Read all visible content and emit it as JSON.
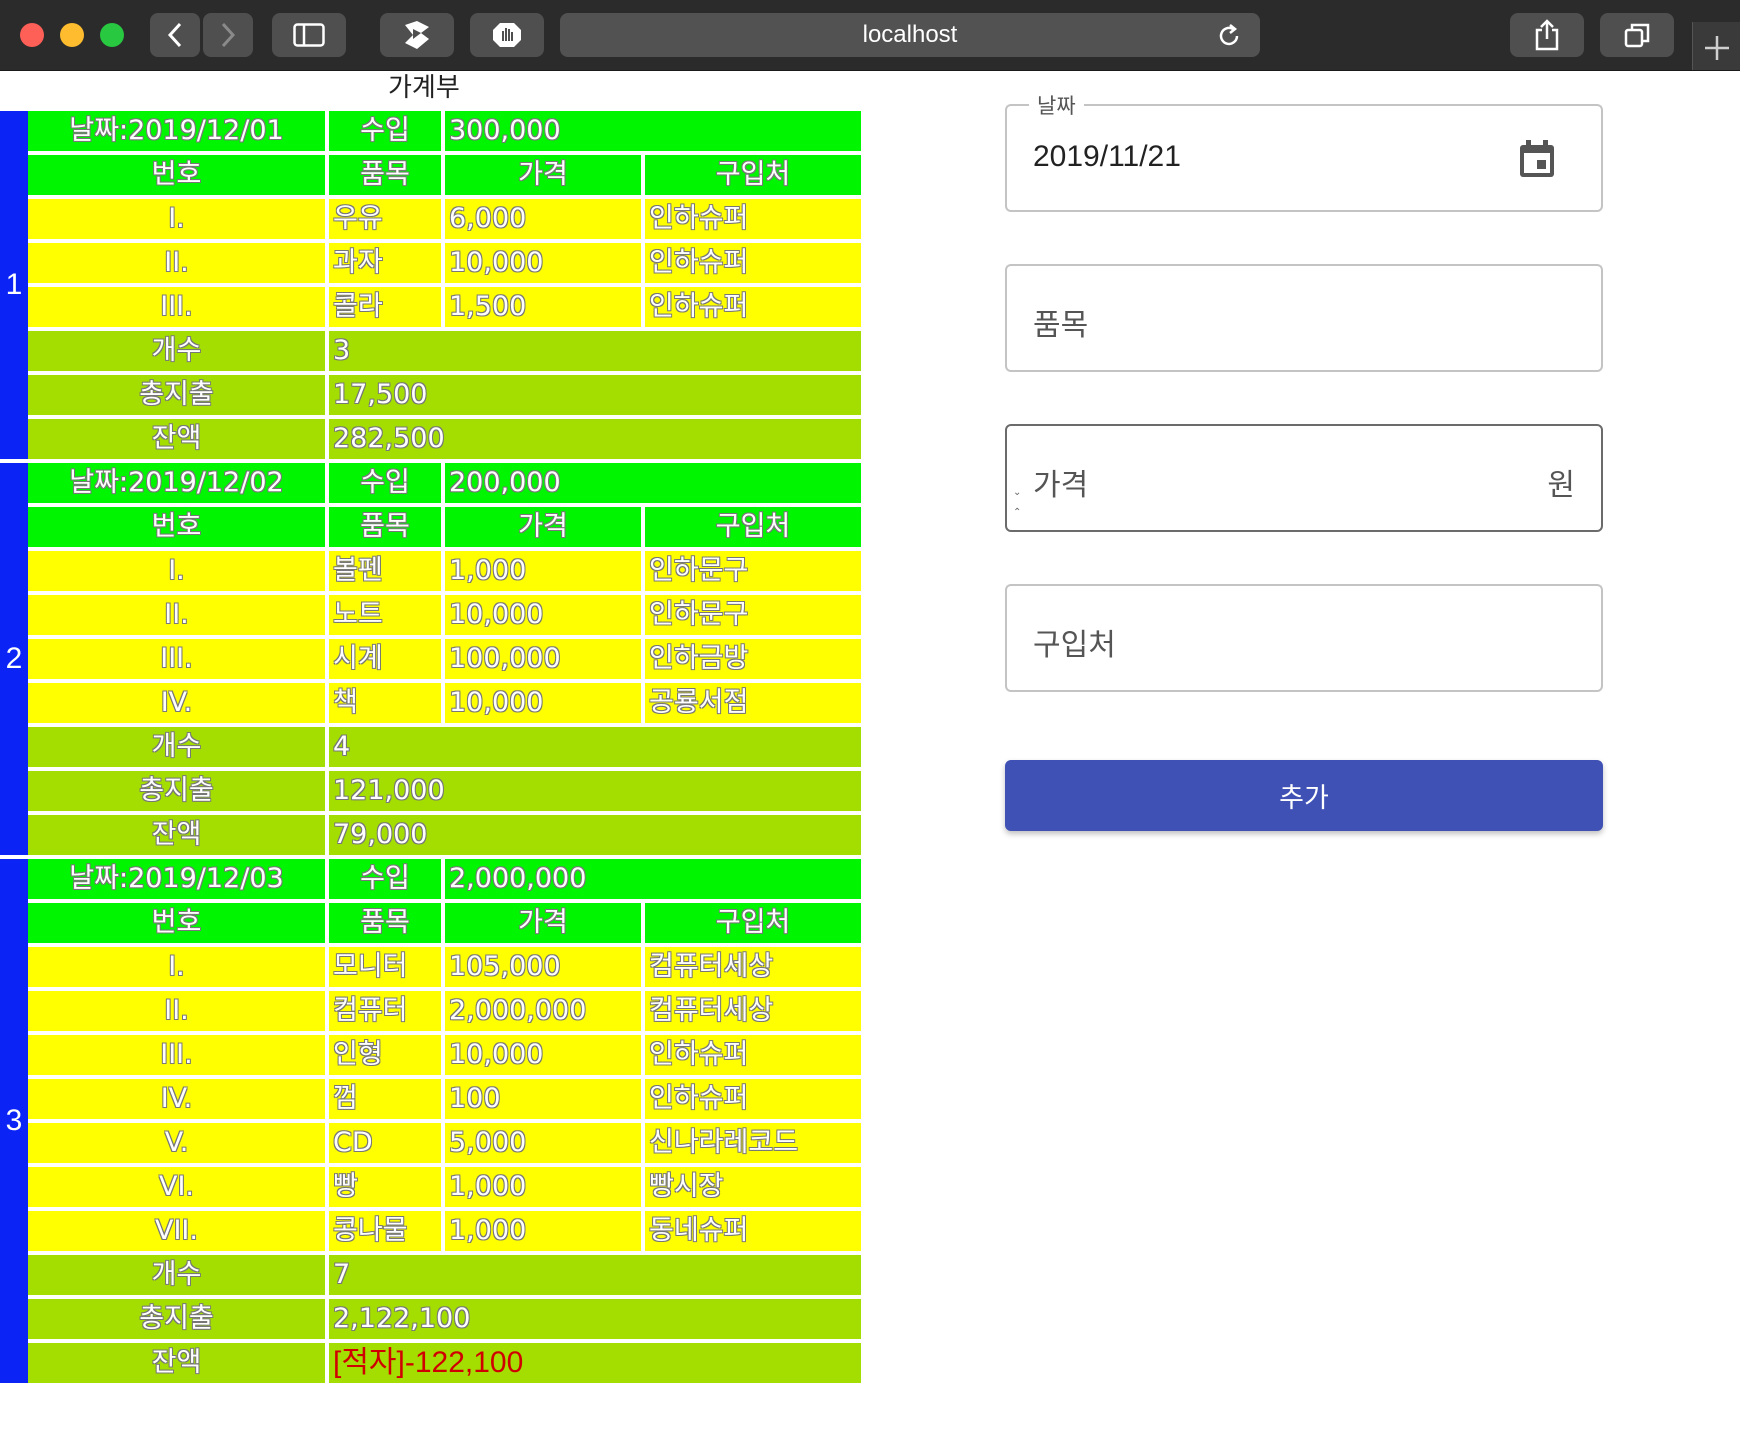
{
  "browser": {
    "url": "localhost"
  },
  "ledger": {
    "title": "가계부",
    "headers": {
      "no": "번호",
      "item": "품목",
      "price": "가격",
      "store": "구입처"
    },
    "labels": {
      "income": "수입",
      "count": "개수",
      "total": "총지출",
      "balance": "잔액"
    },
    "groups": [
      {
        "index": "1",
        "date": "날짜:2019/12/01",
        "income": "300,000",
        "items": [
          [
            "I.",
            "우유",
            "6,000",
            "인하슈퍼"
          ],
          [
            "II.",
            "과자",
            "10,000",
            "인하슈퍼"
          ],
          [
            "III.",
            "콜라",
            "1,500",
            "인하슈퍼"
          ]
        ],
        "count": "3",
        "total": "17,500",
        "balance": "282,500"
      },
      {
        "index": "2",
        "date": "날짜:2019/12/02",
        "income": "200,000",
        "items": [
          [
            "I.",
            "볼펜",
            "1,000",
            "인하문구"
          ],
          [
            "II.",
            "노트",
            "10,000",
            "인하문구"
          ],
          [
            "III.",
            "시계",
            "100,000",
            "인하금방"
          ],
          [
            "IV.",
            "책",
            "10,000",
            "공룡서점"
          ]
        ],
        "count": "4",
        "total": "121,000",
        "balance": "79,000"
      },
      {
        "index": "3",
        "date": "날짜:2019/12/03",
        "income": "2,000,000",
        "items": [
          [
            "I.",
            "모니터",
            "105,000",
            "컴퓨터세상"
          ],
          [
            "II.",
            "컴퓨터",
            "2,000,000",
            "컴퓨터세상"
          ],
          [
            "III.",
            "인형",
            "10,000",
            "인하슈퍼"
          ],
          [
            "IV.",
            "껌",
            "100",
            "인하슈퍼"
          ],
          [
            "V.",
            "CD",
            "5,000",
            "신나라레코드"
          ],
          [
            "VI.",
            "빵",
            "1,000",
            "빵시장"
          ],
          [
            "VII.",
            "콩나물",
            "1,000",
            "동네슈퍼"
          ]
        ],
        "count": "7",
        "total": "2,122,100",
        "balance": "[적자]-122,100",
        "deficit": true
      }
    ]
  },
  "form": {
    "date": {
      "label": "날짜",
      "value": "2019/11/21"
    },
    "item": {
      "placeholder": "품목"
    },
    "price": {
      "placeholder": "가격",
      "unit": "원"
    },
    "store": {
      "placeholder": "구입처"
    },
    "submit_label": "추가"
  },
  "colors": {
    "group_bar": "#0b24f5",
    "header_bg": "#00f500",
    "item_bg": "#ffff00",
    "summary_bg": "#a3de00",
    "deficit": "#d10000",
    "button": "#3f51b5"
  }
}
